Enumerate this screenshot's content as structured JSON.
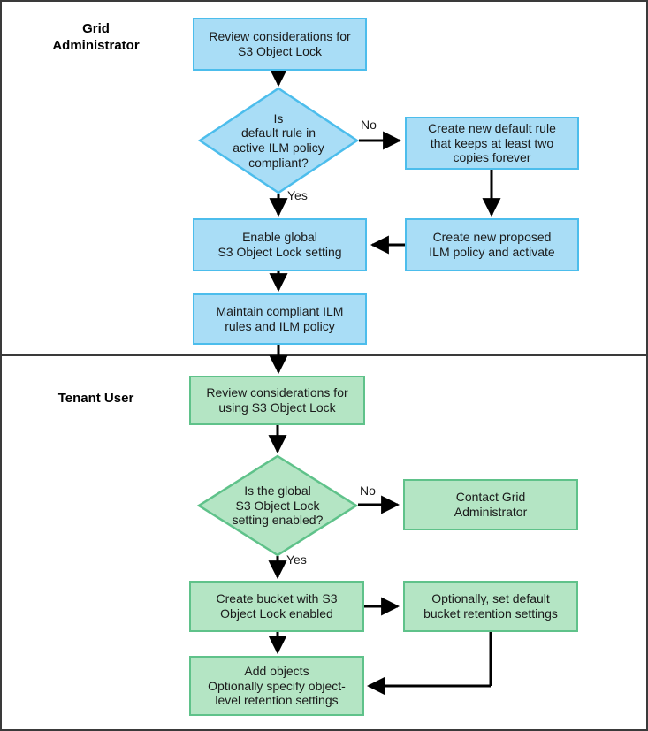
{
  "diagram": {
    "title": "S3 Object Lock workflow",
    "colors": {
      "blue_fill": "#a9ddf6",
      "blue_border": "#4cbdec",
      "green_fill": "#b4e5c4",
      "green_border": "#5fc28a",
      "line": "#000000",
      "frame": "#3a3a3a"
    }
  },
  "swimlanes": [
    {
      "id": "grid-administrator",
      "label": "Grid\nAdministrator"
    },
    {
      "id": "tenant-user",
      "label": "Tenant User"
    }
  ],
  "nodes": {
    "review_considerations": "Review considerations for\nS3 Object Lock",
    "default_rule_compliant": "Is\ndefault rule in\nactive ILM policy\ncompliant?",
    "create_new_default_rule": "Create new default rule\nthat keeps at least two\ncopies forever",
    "create_new_proposed_policy": "Create new proposed\nILM policy and activate",
    "enable_global_setting": "Enable global\nS3 Object Lock setting",
    "maintain_compliant_ilm": "Maintain compliant ILM\nrules and ILM policy",
    "review_considerations_tenant": "Review considerations for\nusing S3 Object Lock",
    "global_setting_enabled": "Is the global\nS3 Object Lock\nsetting enabled?",
    "contact_grid_administrator": "Contact Grid\nAdministrator",
    "create_bucket": "Create bucket with S3\nObject Lock enabled",
    "optional_bucket_retention": "Optionally, set default\nbucket retention settings",
    "add_objects": "Add objects\nOptionally specify object-\nlevel retention settings"
  },
  "edge_labels": {
    "admin_no": "No",
    "admin_yes": "Yes",
    "tenant_no": "No",
    "tenant_yes": "Yes"
  }
}
